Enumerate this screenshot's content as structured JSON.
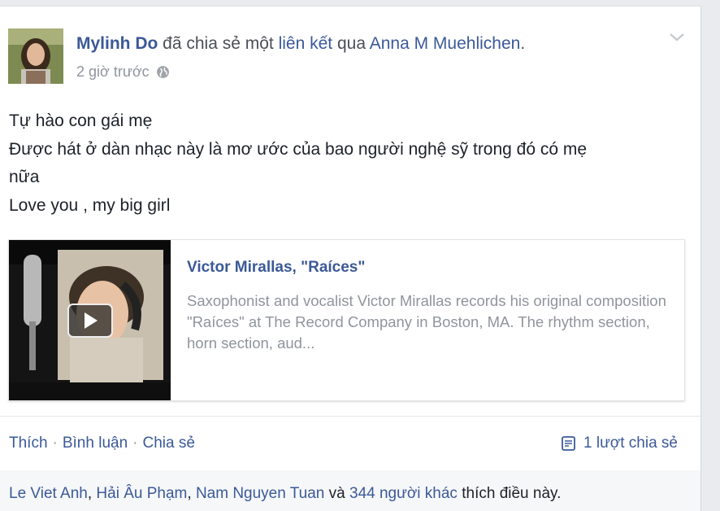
{
  "post": {
    "author": "Mylinh Do",
    "action_text": "đã chia sẻ một",
    "link_word": "liên kết",
    "via_text": "qua",
    "via_user": "Anna M Muehlichen",
    "period": ".",
    "time": "2 giờ trước",
    "privacy_icon": "globe-icon",
    "menu_icon": "chevron-down-icon"
  },
  "message": {
    "lines": [
      "Tự hào con gái mẹ",
      "Được hát ở dàn nhạc này là mơ ước của bao người nghệ sỹ trong đó có mẹ",
      "nữa",
      "Love you , my big girl"
    ]
  },
  "shared": {
    "title": "Victor Mirallas, \"Raíces\"",
    "description": "Saxophonist and vocalist Victor Mirallas records his original composition \"Raíces\" at The Record Company in Boston, MA. The rhythm section, horn section, aud..."
  },
  "actions": {
    "like": "Thích",
    "comment": "Bình luận",
    "share": "Chia sẻ",
    "separator": "·",
    "share_count": "1 lượt chia sẻ"
  },
  "likes": {
    "names": [
      "Le Viet Anh",
      "Hải Âu Phạm",
      "Nam Nguyen Tuan"
    ],
    "comma": ",",
    "and": "và",
    "others": "344 người khác",
    "suffix": "thích điều này."
  },
  "colors": {
    "link": "#3b5998",
    "muted": "#90949c",
    "text": "#1d2129"
  }
}
